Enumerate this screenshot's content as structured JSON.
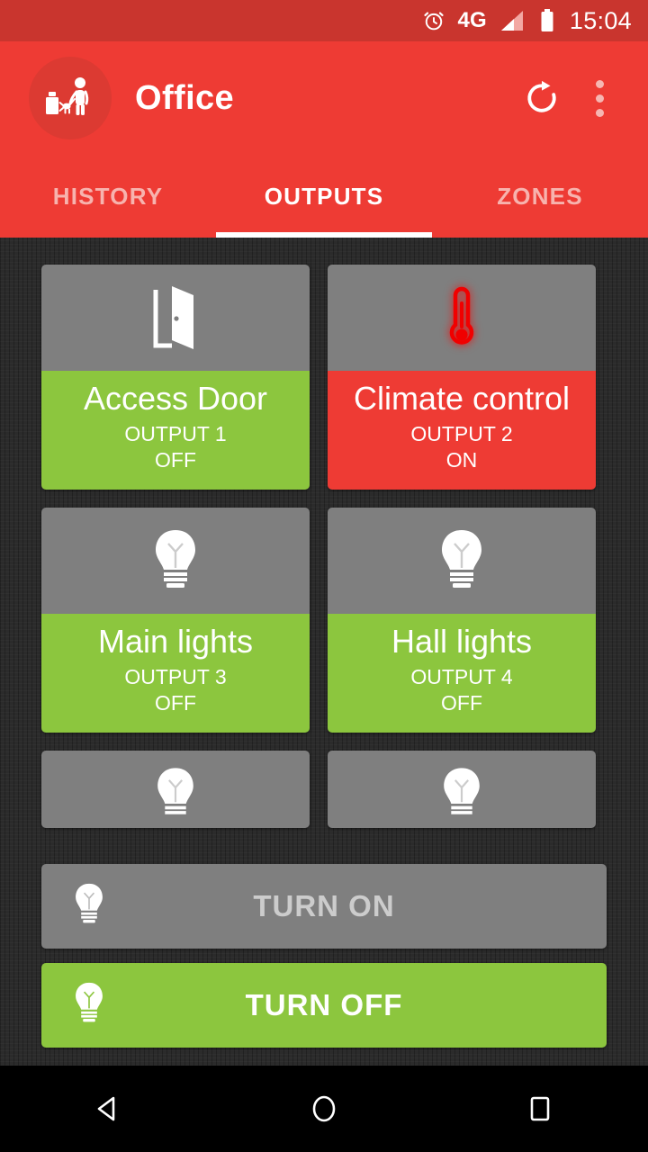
{
  "status_bar": {
    "alarm_icon": "alarm-clock-icon",
    "network_label": "4G",
    "signal_icon": "signal-bars-icon",
    "battery_icon": "battery-full-icon",
    "clock": "15:04"
  },
  "app_bar": {
    "logo_icon": "person-walking-dog-icon",
    "title": "Office",
    "refresh_icon": "refresh-icon",
    "overflow_icon": "more-vertical-icon"
  },
  "tabs": [
    {
      "label": "HISTORY",
      "active": false
    },
    {
      "label": "OUTPUTS",
      "active": true
    },
    {
      "label": "ZONES",
      "active": false
    }
  ],
  "outputs": [
    {
      "name": "Access Door",
      "channel": "OUTPUT 1",
      "state": "OFF",
      "icon": "open-door-icon",
      "partial": false
    },
    {
      "name": "Climate control",
      "channel": "OUTPUT 2",
      "state": "ON",
      "icon": "thermometer-icon",
      "partial": false
    },
    {
      "name": "Main lights",
      "channel": "OUTPUT 3",
      "state": "OFF",
      "icon": "light-bulb-icon",
      "partial": false
    },
    {
      "name": "Hall lights",
      "channel": "OUTPUT 4",
      "state": "OFF",
      "icon": "light-bulb-icon",
      "partial": false
    },
    {
      "name": "",
      "channel": "",
      "state": "",
      "icon": "light-bulb-icon",
      "partial": true
    },
    {
      "name": "",
      "channel": "",
      "state": "",
      "icon": "light-bulb-icon",
      "partial": true
    }
  ],
  "bulk_actions": {
    "turn_on_label": "TURN ON",
    "turn_off_label": "TURN OFF",
    "icon": "light-bulb-icon"
  },
  "nav_bar": {
    "back_icon": "back-triangle-icon",
    "home_icon": "home-circle-icon",
    "recents_icon": "recents-square-icon"
  },
  "colors": {
    "status_bar": "#c9352e",
    "app_bar": "#ee3b34",
    "accent_green": "#8cc63e",
    "accent_red": "#ee3b34",
    "card_gray": "#7f7f7f",
    "background": "#2b2b2b"
  }
}
